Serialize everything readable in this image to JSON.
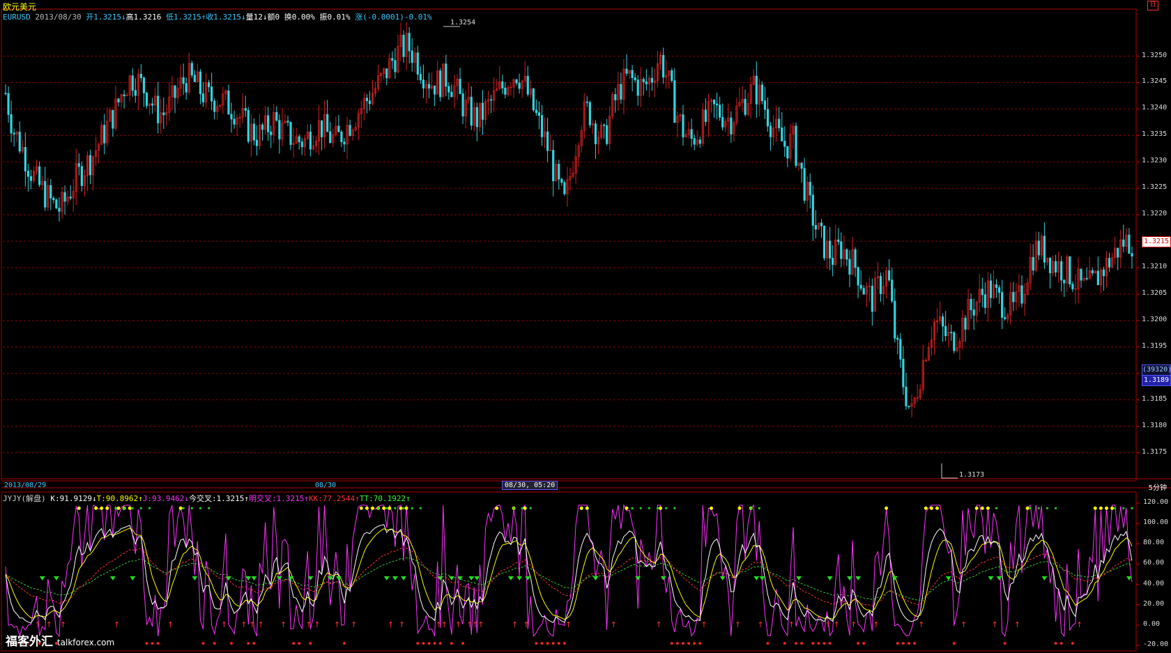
{
  "window": {
    "title": "欧元美元",
    "restore_glyph": "日"
  },
  "info_line": [
    {
      "text": "EURUSD",
      "color": "#3cf"
    },
    {
      "text": " 2013/08/30 ",
      "color": "#bbb"
    },
    {
      "text": "开1.3215↓",
      "color": "#3cf"
    },
    {
      "text": "高1.3216 ",
      "color": "#fff"
    },
    {
      "text": "低1.3215↑",
      "color": "#3cf"
    },
    {
      "text": "收1.3215↓",
      "color": "#3cf"
    },
    {
      "text": "量12↓",
      "color": "#fff"
    },
    {
      "text": "额0 ",
      "color": "#fff"
    },
    {
      "text": "换0.00% ",
      "color": "#fff"
    },
    {
      "text": "振0.01% ",
      "color": "#fff"
    },
    {
      "text": "涨(-0.0001)-0.01%",
      "color": "#3cf"
    }
  ],
  "price_axis": {
    "labels": [
      "1.3250",
      "1.3245",
      "1.3240",
      "1.3235",
      "1.3230",
      "1.3225",
      "1.3220",
      "1.3215",
      "1.3210",
      "1.3205",
      "1.3200",
      "1.3195",
      "1.3190",
      "1.3185",
      "1.3180",
      "1.3175"
    ],
    "current_price": "1.3215",
    "cursor_volume": "(39320)",
    "cursor_price": "1.3189",
    "high_marker": "1.3254",
    "low_marker": "1.3173"
  },
  "time_axis": {
    "left_date": "2013/08/29",
    "mid_date": "08/30",
    "cursor_time": "08/30, 05:20",
    "period": "5分钟"
  },
  "indicator_line": [
    {
      "text": "JYJY(解盘) ",
      "color": "#ccc"
    },
    {
      "text": "K:91.9129↓",
      "color": "#fff"
    },
    {
      "text": "T:90.8962↑",
      "color": "#ff0"
    },
    {
      "text": "J:93.9462↓",
      "color": "#f3f"
    },
    {
      "text": "今交叉:1.3215↑",
      "color": "#fff"
    },
    {
      "text": "明交叉:1.3215↑",
      "color": "#f3f"
    },
    {
      "text": "KK:77.2544↑",
      "color": "#f33"
    },
    {
      "text": "TT:70.1922↑",
      "color": "#3f3"
    }
  ],
  "indicator_axis": {
    "labels": [
      "120.00",
      "100.00",
      "80.00",
      "60.00",
      "40.00",
      "20.00",
      "0.00",
      "-20.00"
    ]
  },
  "watermark": {
    "cn": "福客外汇",
    "en": "talkforex.com"
  },
  "colors": {
    "up": "#d02020",
    "down": "#33d4e0",
    "grid": "#8a0000",
    "frame": "#b00000"
  },
  "chart_data": {
    "type": "candlestick",
    "symbol": "EURUSD",
    "timeframe": "5分钟",
    "ylim": [
      1.3171,
      1.3256
    ],
    "high": 1.3254,
    "low": 1.3173,
    "last": 1.3215,
    "close_path": [
      1.3243,
      1.3236,
      1.3233,
      1.3229,
      1.3226,
      1.3224,
      1.3222,
      1.3221,
      1.3224,
      1.3227,
      1.3229,
      1.3231,
      1.3234,
      1.3237,
      1.324,
      1.3244,
      1.3246,
      1.3245,
      1.3243,
      1.324,
      1.3239,
      1.3241,
      1.3244,
      1.3246,
      1.3245,
      1.3243,
      1.3242,
      1.3242,
      1.3241,
      1.324,
      1.3238,
      1.3236,
      1.3235,
      1.3236,
      1.3238,
      1.3236,
      1.3235,
      1.3234,
      1.3234,
      1.3236,
      1.3237,
      1.3235,
      1.3234,
      1.3236,
      1.3238,
      1.324,
      1.3242,
      1.3244,
      1.3246,
      1.3249,
      1.3251,
      1.3252,
      1.325,
      1.3247,
      1.3245,
      1.3245,
      1.3246,
      1.3244,
      1.3241,
      1.3239,
      1.3238,
      1.324,
      1.3242,
      1.3244,
      1.3246,
      1.3247,
      1.3244,
      1.324,
      1.3236,
      1.3232,
      1.3226,
      1.3222,
      1.323,
      1.3238,
      1.324,
      1.3236,
      1.3234,
      1.324,
      1.3244,
      1.3246,
      1.3245,
      1.3244,
      1.3246,
      1.325,
      1.3246,
      1.324,
      1.3236,
      1.3234,
      1.3236,
      1.3238,
      1.324,
      1.3239,
      1.3238,
      1.324,
      1.3242,
      1.3244,
      1.3242,
      1.3238,
      1.3235,
      1.3233,
      1.3234,
      1.3228,
      1.3222,
      1.3217,
      1.3214,
      1.3212,
      1.3214,
      1.3212,
      1.321,
      1.3206,
      1.3204,
      1.3207,
      1.3209,
      1.3196,
      1.3188,
      1.3182,
      1.3189,
      1.3196,
      1.32,
      1.3198,
      1.3196,
      1.3198,
      1.3201,
      1.3203,
      1.3205,
      1.3206,
      1.3204,
      1.3203,
      1.3202,
      1.3205,
      1.3211,
      1.3214,
      1.3213,
      1.3211,
      1.321,
      1.3209,
      1.3207,
      1.3206,
      1.3207,
      1.3209,
      1.3211,
      1.3213,
      1.3215,
      1.3215
    ]
  }
}
